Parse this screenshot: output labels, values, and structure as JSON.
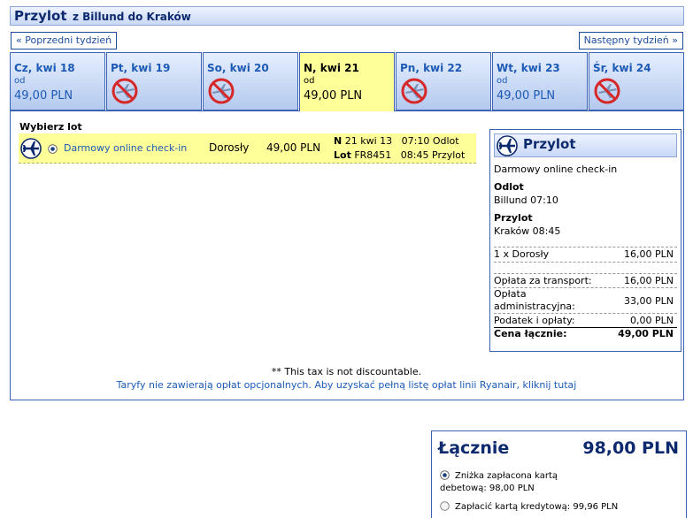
{
  "header": {
    "title": "Przylot",
    "route": "z Billund do Kraków"
  },
  "nav": {
    "prev_week": "« Poprzedni tydzień",
    "next_week": "Następny tydzień »"
  },
  "days": [
    {
      "label": "Cz, kwi 18",
      "od": "od",
      "price": "49,00 PLN",
      "available": true,
      "selected": false
    },
    {
      "label": "Pt, kwi 19",
      "od": "",
      "price": "",
      "available": false,
      "selected": false
    },
    {
      "label": "So, kwi 20",
      "od": "",
      "price": "",
      "available": false,
      "selected": false
    },
    {
      "label": "N, kwi 21",
      "od": "od",
      "price": "49,00 PLN",
      "available": true,
      "selected": true
    },
    {
      "label": "Pn, kwi 22",
      "od": "",
      "price": "",
      "available": false,
      "selected": false
    },
    {
      "label": "Wt, kwi 23",
      "od": "od",
      "price": "49,00 PLN",
      "available": true,
      "selected": false
    },
    {
      "label": "Śr, kwi 24",
      "od": "",
      "price": "",
      "available": false,
      "selected": false
    }
  ],
  "flight": {
    "select_label": "Wybierz lot",
    "fare_name": "Darmowy online check-in",
    "passenger": "Dorosły",
    "price": "49,00 PLN",
    "day_code": "N",
    "date": "21 kwi 13",
    "dep_time": "07:10",
    "dep_label": "Odlot",
    "lot_label": "Lot",
    "flight_no": "FR8451",
    "arr_time": "08:45",
    "arr_label": "Przylot"
  },
  "summary": {
    "title": "Przylot",
    "fare_name": "Darmowy online check-in",
    "dep_label": "Odlot",
    "dep_value": "Billund 07:10",
    "arr_label": "Przylot",
    "arr_value": "Kraków 08:45",
    "pax_label": "1 x Dorosły",
    "pax_value": "16,00 PLN",
    "transport_label": "Opłata za transport:",
    "transport_value": "16,00 PLN",
    "admin_label_1": "Opłata",
    "admin_label_2": "administracyjna:",
    "admin_value": "33,00 PLN",
    "tax_label": "Podatek i opłaty:",
    "tax_value": "0,00 PLN",
    "total_label": "Cena łącznie:",
    "total_value": "49,00 PLN"
  },
  "notes": {
    "tax": "** This tax is not discountable.",
    "fees_link": "Taryfy nie zawierają opłat opcjonalnych. Aby uzyskać pełną listę opłat linii Ryanair, kliknij tutaj"
  },
  "total": {
    "label": "Łącznie",
    "value": "98,00 PLN",
    "option1_line1": "Zniżka zapłacona kartą",
    "option1_line2": "debetową: 98,00 PLN",
    "option2": "Zapłacić kartą kredytową: 99,96 PLN"
  },
  "colors": {
    "accent": "#1c5ab6",
    "heading": "#0e2a6e",
    "selected": "#ffff99",
    "unavailable": "#d62828"
  },
  "icons": {
    "flight": "plane-circle-icon",
    "unavailable": "no-flight-icon"
  }
}
